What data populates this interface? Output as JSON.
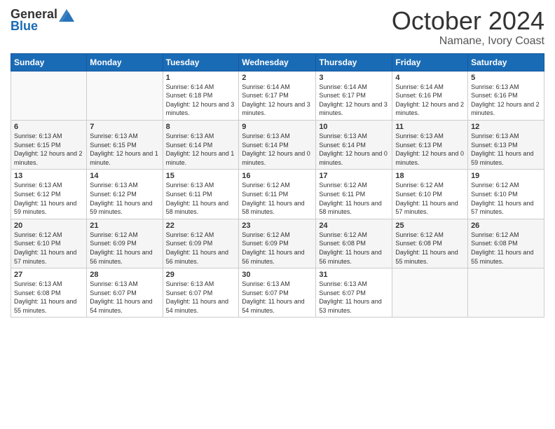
{
  "header": {
    "logo_general": "General",
    "logo_blue": "Blue",
    "month": "October 2024",
    "location": "Namane, Ivory Coast"
  },
  "weekdays": [
    "Sunday",
    "Monday",
    "Tuesday",
    "Wednesday",
    "Thursday",
    "Friday",
    "Saturday"
  ],
  "weeks": [
    [
      {
        "day": "",
        "info": ""
      },
      {
        "day": "",
        "info": ""
      },
      {
        "day": "1",
        "info": "Sunrise: 6:14 AM\nSunset: 6:18 PM\nDaylight: 12 hours and 3 minutes."
      },
      {
        "day": "2",
        "info": "Sunrise: 6:14 AM\nSunset: 6:17 PM\nDaylight: 12 hours and 3 minutes."
      },
      {
        "day": "3",
        "info": "Sunrise: 6:14 AM\nSunset: 6:17 PM\nDaylight: 12 hours and 3 minutes."
      },
      {
        "day": "4",
        "info": "Sunrise: 6:14 AM\nSunset: 6:16 PM\nDaylight: 12 hours and 2 minutes."
      },
      {
        "day": "5",
        "info": "Sunrise: 6:13 AM\nSunset: 6:16 PM\nDaylight: 12 hours and 2 minutes."
      }
    ],
    [
      {
        "day": "6",
        "info": "Sunrise: 6:13 AM\nSunset: 6:15 PM\nDaylight: 12 hours and 2 minutes."
      },
      {
        "day": "7",
        "info": "Sunrise: 6:13 AM\nSunset: 6:15 PM\nDaylight: 12 hours and 1 minute."
      },
      {
        "day": "8",
        "info": "Sunrise: 6:13 AM\nSunset: 6:14 PM\nDaylight: 12 hours and 1 minute."
      },
      {
        "day": "9",
        "info": "Sunrise: 6:13 AM\nSunset: 6:14 PM\nDaylight: 12 hours and 0 minutes."
      },
      {
        "day": "10",
        "info": "Sunrise: 6:13 AM\nSunset: 6:14 PM\nDaylight: 12 hours and 0 minutes."
      },
      {
        "day": "11",
        "info": "Sunrise: 6:13 AM\nSunset: 6:13 PM\nDaylight: 12 hours and 0 minutes."
      },
      {
        "day": "12",
        "info": "Sunrise: 6:13 AM\nSunset: 6:13 PM\nDaylight: 11 hours and 59 minutes."
      }
    ],
    [
      {
        "day": "13",
        "info": "Sunrise: 6:13 AM\nSunset: 6:12 PM\nDaylight: 11 hours and 59 minutes."
      },
      {
        "day": "14",
        "info": "Sunrise: 6:13 AM\nSunset: 6:12 PM\nDaylight: 11 hours and 59 minutes."
      },
      {
        "day": "15",
        "info": "Sunrise: 6:13 AM\nSunset: 6:11 PM\nDaylight: 11 hours and 58 minutes."
      },
      {
        "day": "16",
        "info": "Sunrise: 6:12 AM\nSunset: 6:11 PM\nDaylight: 11 hours and 58 minutes."
      },
      {
        "day": "17",
        "info": "Sunrise: 6:12 AM\nSunset: 6:11 PM\nDaylight: 11 hours and 58 minutes."
      },
      {
        "day": "18",
        "info": "Sunrise: 6:12 AM\nSunset: 6:10 PM\nDaylight: 11 hours and 57 minutes."
      },
      {
        "day": "19",
        "info": "Sunrise: 6:12 AM\nSunset: 6:10 PM\nDaylight: 11 hours and 57 minutes."
      }
    ],
    [
      {
        "day": "20",
        "info": "Sunrise: 6:12 AM\nSunset: 6:10 PM\nDaylight: 11 hours and 57 minutes."
      },
      {
        "day": "21",
        "info": "Sunrise: 6:12 AM\nSunset: 6:09 PM\nDaylight: 11 hours and 56 minutes."
      },
      {
        "day": "22",
        "info": "Sunrise: 6:12 AM\nSunset: 6:09 PM\nDaylight: 11 hours and 56 minutes."
      },
      {
        "day": "23",
        "info": "Sunrise: 6:12 AM\nSunset: 6:09 PM\nDaylight: 11 hours and 56 minutes."
      },
      {
        "day": "24",
        "info": "Sunrise: 6:12 AM\nSunset: 6:08 PM\nDaylight: 11 hours and 56 minutes."
      },
      {
        "day": "25",
        "info": "Sunrise: 6:12 AM\nSunset: 6:08 PM\nDaylight: 11 hours and 55 minutes."
      },
      {
        "day": "26",
        "info": "Sunrise: 6:12 AM\nSunset: 6:08 PM\nDaylight: 11 hours and 55 minutes."
      }
    ],
    [
      {
        "day": "27",
        "info": "Sunrise: 6:13 AM\nSunset: 6:08 PM\nDaylight: 11 hours and 55 minutes."
      },
      {
        "day": "28",
        "info": "Sunrise: 6:13 AM\nSunset: 6:07 PM\nDaylight: 11 hours and 54 minutes."
      },
      {
        "day": "29",
        "info": "Sunrise: 6:13 AM\nSunset: 6:07 PM\nDaylight: 11 hours and 54 minutes."
      },
      {
        "day": "30",
        "info": "Sunrise: 6:13 AM\nSunset: 6:07 PM\nDaylight: 11 hours and 54 minutes."
      },
      {
        "day": "31",
        "info": "Sunrise: 6:13 AM\nSunset: 6:07 PM\nDaylight: 11 hours and 53 minutes."
      },
      {
        "day": "",
        "info": ""
      },
      {
        "day": "",
        "info": ""
      }
    ]
  ]
}
